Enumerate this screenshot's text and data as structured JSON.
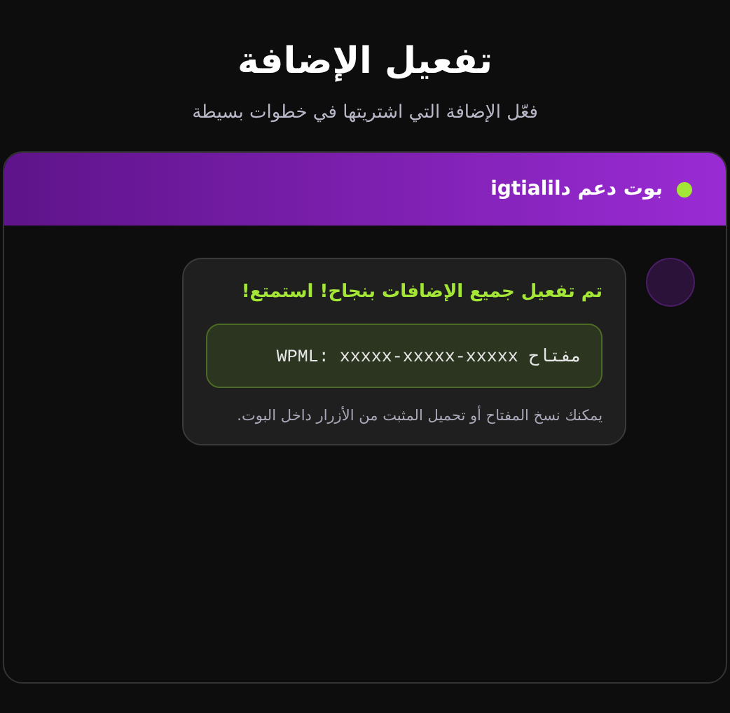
{
  "title": "تفعيل الإضافة",
  "subtitle": "فعّل الإضافة التي اشتريتها في خطوات بسيطة",
  "chat": {
    "header": {
      "name": "بوت دعم داigtiali"
    },
    "messages": [
      {
        "heading": "تم تفعيل جميع الإضافات بنجاح! استمتع!",
        "key": "مفتاح WPML: xxxxx-xxxxx-xxxxx",
        "note": "يمكنك نسخ المفتاح أو تحميل المثبت من الأزرار داخل البوت."
      }
    ]
  }
}
